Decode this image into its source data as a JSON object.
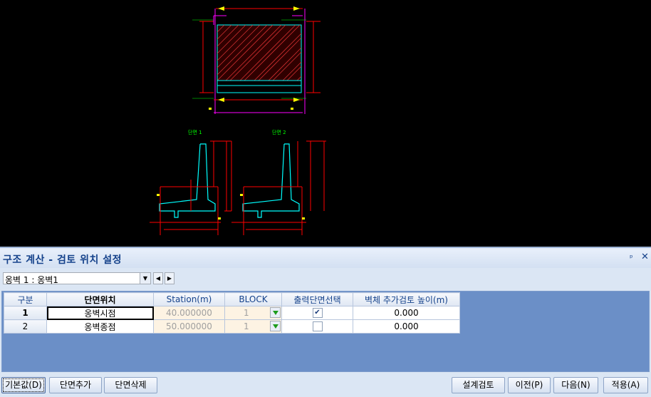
{
  "drawing": {
    "section1_label": "단면 1",
    "section2_label": "단면 2"
  },
  "panel": {
    "title": "구조 계산 - 검토 위치 설정",
    "pin_glyph": "ᵖ",
    "close_glyph": "✕",
    "selector": {
      "value": "옹벽 1 : 옹벽1",
      "arrow": "▼",
      "prev": "◀",
      "next": "▶"
    },
    "grid": {
      "headers": [
        "구분",
        "단면위치",
        "Station(m)",
        "BLOCK",
        "출력단면선택",
        "벽체 추가검토 높이(m)"
      ],
      "rows": [
        {
          "no": "1",
          "location": "옹벽시점",
          "station": "40.000000",
          "block": "1",
          "output": true,
          "extra_height": "0.000"
        },
        {
          "no": "2",
          "location": "옹벽종점",
          "station": "50.000000",
          "block": "1",
          "output": false,
          "extra_height": "0.000"
        }
      ]
    },
    "buttons": {
      "default": "기본값(D)",
      "add_section": "단면추가",
      "delete_section": "단면삭제",
      "design_check": "설계검토",
      "prev": "이전(P)",
      "next": "다음(N)",
      "apply": "적용(A)"
    }
  },
  "colors": {
    "background": "#000000",
    "wall_outline": "#00ffff",
    "dimension": "#ff0000",
    "hatch": "#d03030",
    "leader": "#ff00ff",
    "label": "#00ff00",
    "marker": "#ffff00"
  }
}
